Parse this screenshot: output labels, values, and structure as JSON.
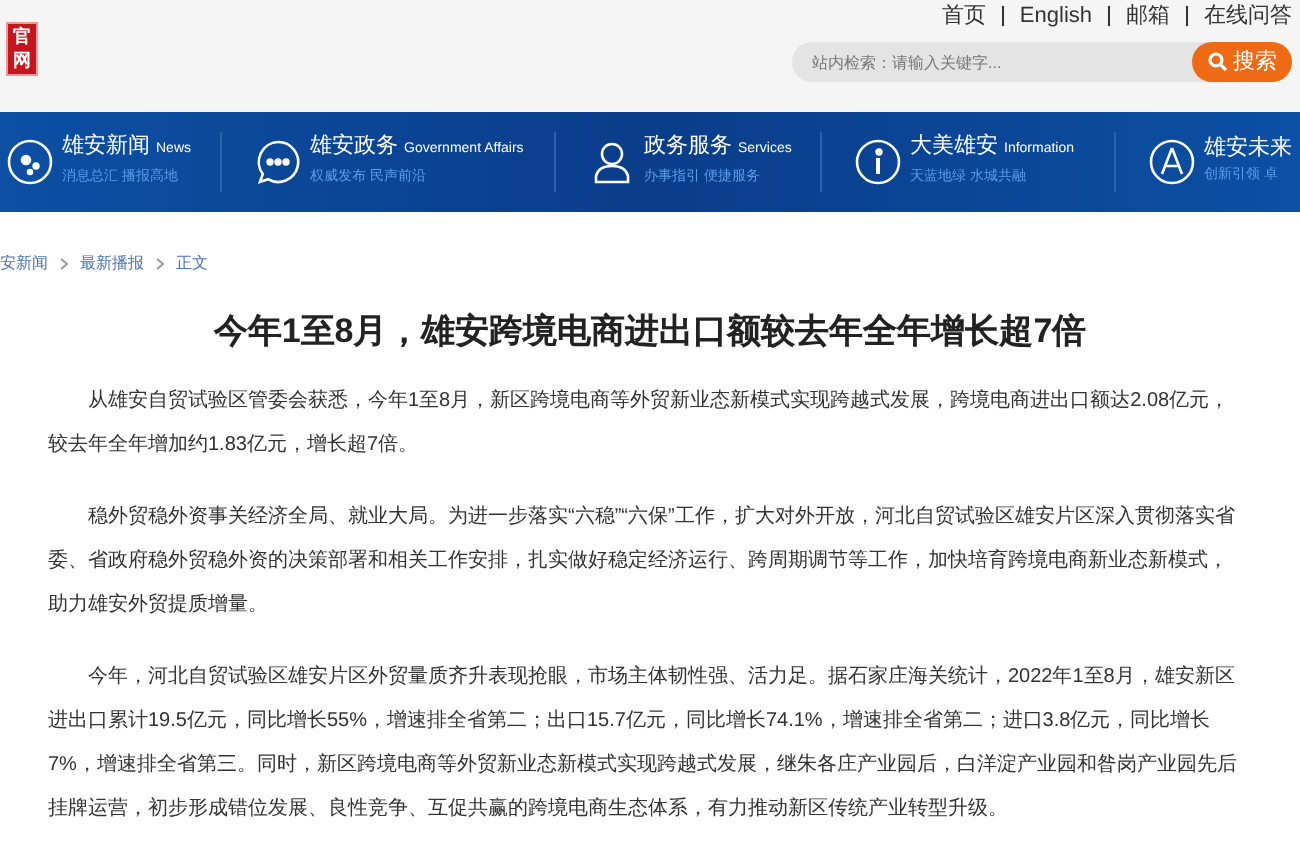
{
  "header": {
    "logo": "官网",
    "top_links": [
      "首页",
      "English",
      "邮箱",
      "在线问答"
    ],
    "search": {
      "placeholder": "站内检索：请输入关键字...",
      "button": "搜索"
    }
  },
  "nav": [
    {
      "kind": "news",
      "title": "雄安新闻",
      "en": "News",
      "sub": "消息总汇 播报高地"
    },
    {
      "kind": "chat",
      "title": "雄安政务",
      "en": "Government Affairs",
      "sub": "权威发布 民声前沿"
    },
    {
      "kind": "person",
      "title": "政务服务",
      "en": "Services",
      "sub": "办事指引 便捷服务"
    },
    {
      "kind": "info",
      "title": "大美雄安",
      "en": "Information",
      "sub": "天蓝地绿 水城共融"
    },
    {
      "kind": "compass",
      "title": "雄安未来",
      "sub": "创新引领 卓"
    }
  ],
  "breadcrumb": [
    "安新闻",
    "最新播报",
    "正文"
  ],
  "article": {
    "title": "今年1至8月，雄安跨境电商进出口额较去年全年增长超7倍",
    "paragraphs": [
      "从雄安自贸试验区管委会获悉，今年1至8月，新区跨境电商等外贸新业态新模式实现跨越式发展，跨境电商进出口额达2.08亿元，较去年全年增加约1.83亿元，增长超7倍。",
      "稳外贸稳外资事关经济全局、就业大局。为进一步落实“六稳”“六保”工作，扩大对外开放，河北自贸试验区雄安片区深入贯彻落实省委、省政府稳外贸稳外资的决策部署和相关工作安排，扎实做好稳定经济运行、跨周期调节等工作，加快培育跨境电商新业态新模式，助力雄安外贸提质增量。",
      "今年，河北自贸试验区雄安片区外贸量质齐升表现抢眼，市场主体韧性强、活力足。据石家庄海关统计，2022年1至8月，雄安新区进出口累计19.5亿元，同比增长55%，增速排全省第二；出口15.7亿元，同比增长74.1%，增速排全省第二；进口3.8亿元，同比增长7%，增速排全省第三。同时，新区跨境电商等外贸新业态新模式实现跨越式发展，继朱各庄产业园后，白洋淀产业园和昝岗产业园先后挂牌运营，初步形成错位发展、良性竞争、互促共赢的跨境电商生态体系，有力推动新区传统产业转型升级。"
    ]
  }
}
